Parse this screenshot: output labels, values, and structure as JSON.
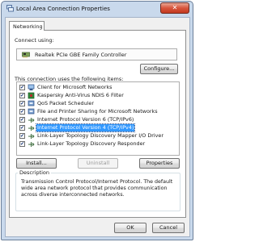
{
  "window": {
    "title": "Local Area Connection Properties",
    "close_glyph": "✕"
  },
  "tabs": [
    {
      "label": "Networking",
      "active": true
    }
  ],
  "connect_using": {
    "label": "Connect using:",
    "adapter_name": "Realtek PCIe GBE Family Controller",
    "adapter_icon": "network-adapter-icon"
  },
  "configure_button": "Configure...",
  "items_label": "This connection uses the following items:",
  "items": [
    {
      "label": "Client for Microsoft Networks",
      "checked": true,
      "icon": "client-icon",
      "selected": false
    },
    {
      "label": "Kaspersky Anti-Virus NDIS 6 Filter",
      "checked": true,
      "icon": "kaspersky-icon",
      "selected": false
    },
    {
      "label": "QoS Packet Scheduler",
      "checked": true,
      "icon": "service-icon",
      "selected": false
    },
    {
      "label": "File and Printer Sharing for Microsoft Networks",
      "checked": true,
      "icon": "service-icon",
      "selected": false
    },
    {
      "label": "Internet Protocol Version 6 (TCP/IPv6)",
      "checked": true,
      "icon": "protocol-icon",
      "selected": false
    },
    {
      "label": "Internet Protocol Version 4 (TCP/IPv4)",
      "checked": true,
      "icon": "protocol-icon",
      "selected": true
    },
    {
      "label": "Link-Layer Topology Discovery Mapper I/O Driver",
      "checked": true,
      "icon": "protocol-icon",
      "selected": false
    },
    {
      "label": "Link-Layer Topology Discovery Responder",
      "checked": true,
      "icon": "protocol-icon",
      "selected": false
    }
  ],
  "item_buttons": {
    "install": "Install...",
    "uninstall": "Uninstall",
    "properties": "Properties"
  },
  "description": {
    "label": "Description",
    "text": "Transmission Control Protocol/Internet Protocol. The default wide area network protocol that provides communication across diverse interconnected networks."
  },
  "footer_buttons": {
    "ok": "OK",
    "cancel": "Cancel"
  },
  "colors": {
    "selection": "#3399ff",
    "title_bar": "#c9d9ec",
    "close_button": "#c94a32"
  },
  "check_glyph": "✔"
}
